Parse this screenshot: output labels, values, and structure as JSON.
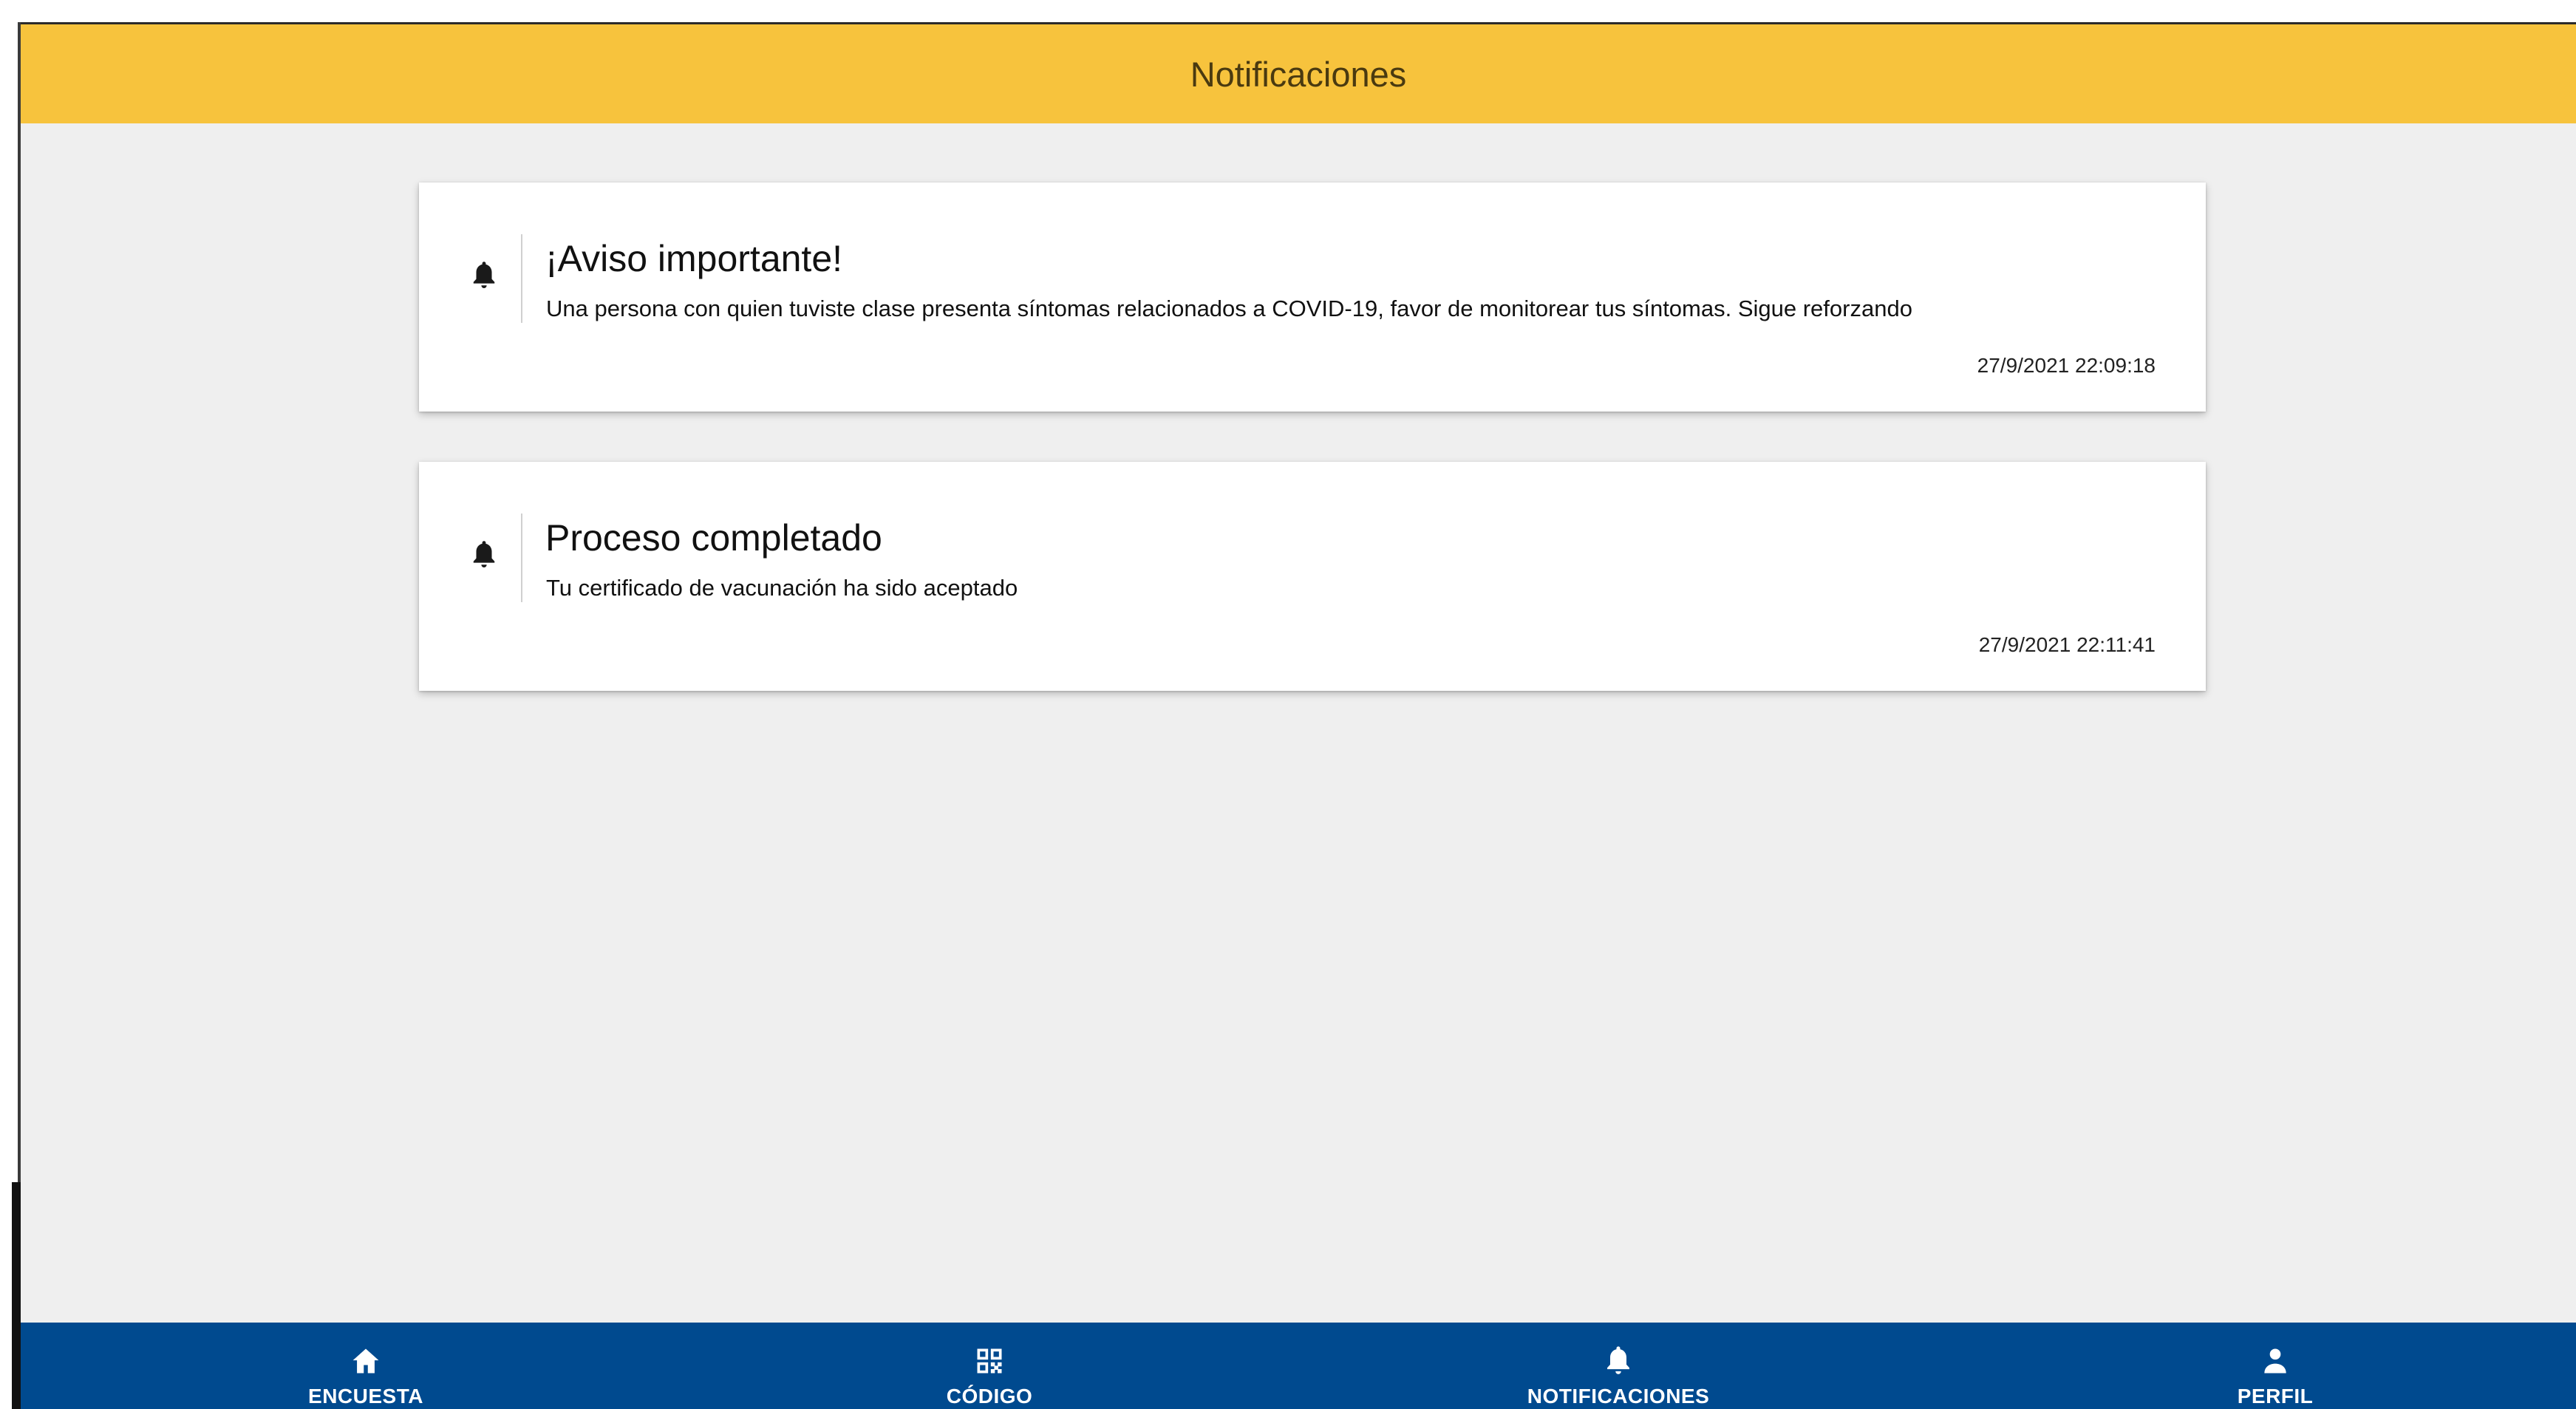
{
  "header": {
    "title": "Notificaciones",
    "background": "#f7c33d"
  },
  "notifications": [
    {
      "icon": "bell-icon",
      "title": "¡Aviso importante!",
      "message": "Una persona con quien tuviste clase presenta síntomas relacionados a COVID-19, favor de monitorear tus síntomas. Sigue reforzando",
      "timestamp": "27/9/2021 22:09:18"
    },
    {
      "icon": "bell-icon",
      "title": "Proceso completado",
      "message": "Tu certificado de vacunación ha sido aceptado",
      "timestamp": "27/9/2021 22:11:41"
    }
  ],
  "bottom_nav": {
    "background": "#004a8f",
    "items": [
      {
        "icon": "home-icon",
        "label": "ENCUESTA"
      },
      {
        "icon": "qr-code-icon",
        "label": "CÓDIGO"
      },
      {
        "icon": "bell-icon",
        "label": "NOTIFICACIONES",
        "active": true
      },
      {
        "icon": "person-icon",
        "label": "PERFIL"
      }
    ]
  }
}
